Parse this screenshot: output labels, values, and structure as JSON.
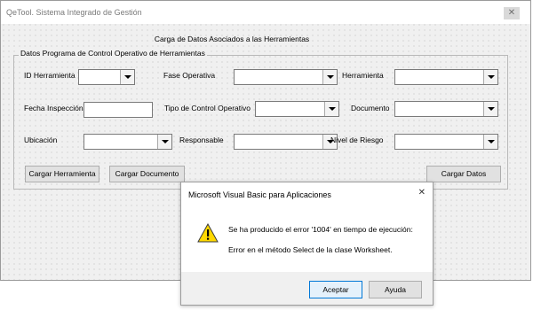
{
  "window": {
    "title": "QeTool. Sistema Integrado de Gestión",
    "close_glyph": "✕"
  },
  "form": {
    "heading": "Carga de Datos Asociados a las Herramientas",
    "group_label": "Datos Programa de Control Operativo de Herramientas",
    "labels": {
      "id_herramienta": "ID Herramienta",
      "fase_operativa": "Fase Operativa",
      "herramienta": "Herramienta",
      "fecha_inspeccion": "Fecha Inspección",
      "tipo_control": "Tipo de Control Operativo",
      "documento": "Documento",
      "ubicacion": "Ubicación",
      "responsable": "Responsable",
      "nivel_riesgo": "Nivel de Riesgo"
    },
    "values": {
      "id_herramienta": "",
      "fase_operativa": "",
      "herramienta": "",
      "fecha_inspeccion": "",
      "tipo_control": "",
      "documento": "",
      "ubicacion": "",
      "responsable": "",
      "nivel_riesgo": ""
    },
    "buttons": {
      "cargar_herramienta": "Cargar Herramienta",
      "cargar_documento": "Cargar Documento",
      "cargar_datos": "Cargar Datos"
    }
  },
  "dialog": {
    "title": "Microsoft Visual Basic para Aplicaciones",
    "close_glyph": "✕",
    "message_line1": "Se ha producido el error '1004' en tiempo de ejecución:",
    "message_line2": "Error en el método Select de la clase Worksheet.",
    "icon": "warning-icon",
    "buttons": {
      "accept": "Aceptar",
      "help": "Ayuda"
    }
  },
  "colors": {
    "accent_border": "#0078d7",
    "warning_yellow": "#ffd800"
  }
}
